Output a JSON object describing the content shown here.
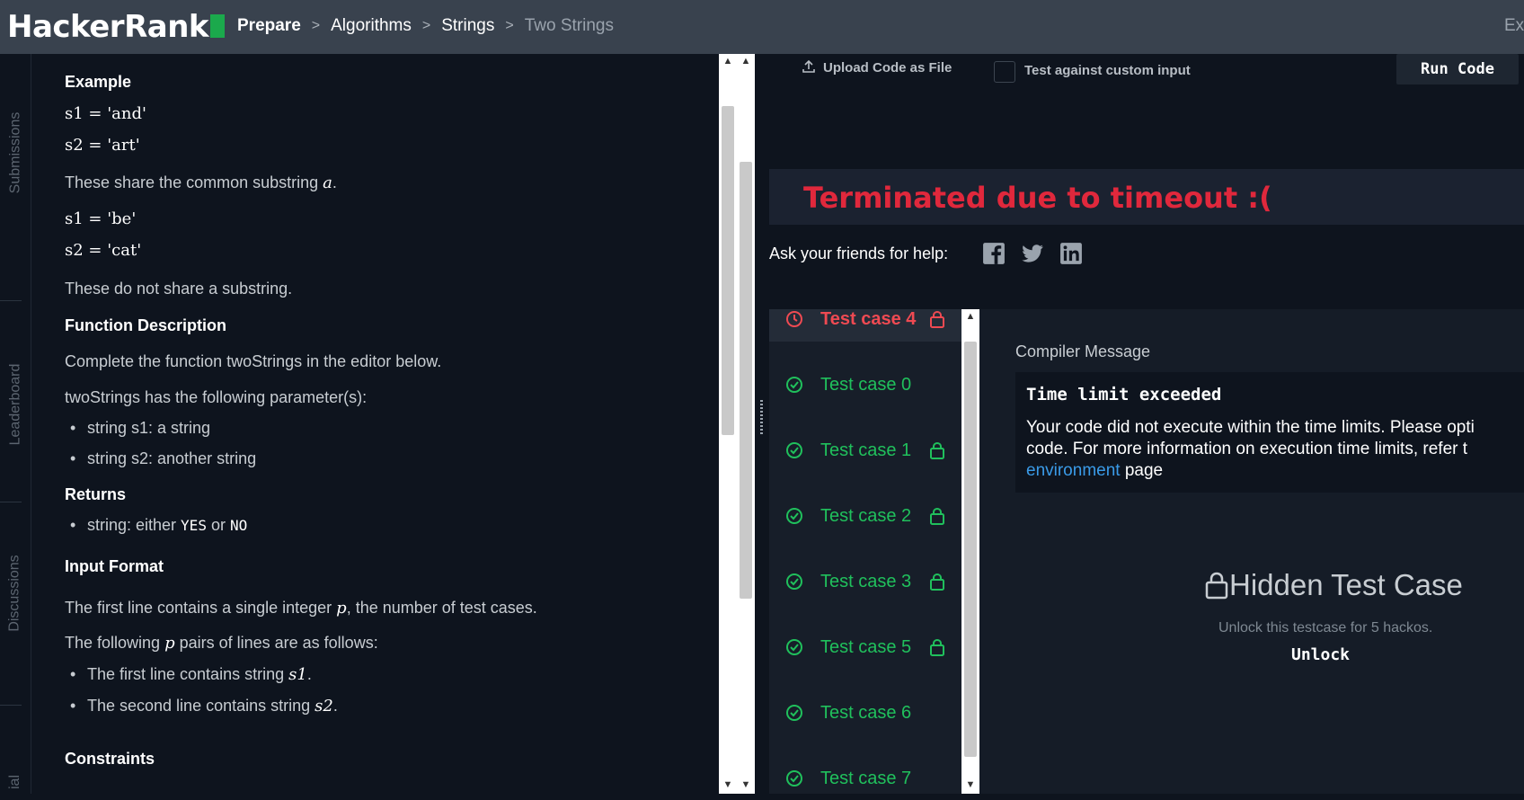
{
  "header": {
    "logo": "HackerRank",
    "breadcrumbs": [
      "Prepare",
      "Algorithms",
      "Strings",
      "Two Strings"
    ],
    "exit_label": "Exi"
  },
  "leftnav": {
    "tabs": [
      "Submissions",
      "Leaderboard",
      "Discussions",
      "ial"
    ]
  },
  "problem": {
    "example_heading": "Example",
    "ex1_s1": "s1 = 'and'",
    "ex1_s2": "s2 = 'art'",
    "ex1_note_a": "These share the common substring ",
    "ex1_note_var": "a",
    "ex1_note_b": ".",
    "ex2_s1": "s1 = 'be'",
    "ex2_s2": "s2 = 'cat'",
    "ex2_note": "These do not share a substring.",
    "fd_heading": "Function Description",
    "fd_text": "Complete the function twoStrings in the editor below.",
    "params_text": "twoStrings has the following parameter(s):",
    "param1": "string s1: a string",
    "param2": "string s2: another string",
    "returns_heading": "Returns",
    "returns_a": "string: either ",
    "returns_yes": "YES",
    "returns_or": " or ",
    "returns_no": "NO",
    "input_heading": "Input Format",
    "input_line1_a": "The first line contains a single integer ",
    "input_line1_var": "p",
    "input_line1_b": ", the number of test cases.",
    "input_line2_a": "The following ",
    "input_line2_var": "p",
    "input_line2_b": " pairs of lines are as follows:",
    "input_b1_a": "The first line contains string ",
    "input_b1_var": "s1",
    "input_b1_b": ".",
    "input_b2_a": "The second line contains string ",
    "input_b2_var": "s2",
    "input_b2_b": ".",
    "constraints_heading": "Constraints"
  },
  "editor": {
    "upload_label": "Upload Code as File",
    "custom_input_label": "Test against custom input",
    "run_label": "Run Code"
  },
  "result": {
    "status": "Terminated due to timeout :(",
    "ask_label": "Ask your friends for help:",
    "social_icons": [
      "facebook-icon",
      "twitter-icon",
      "linkedin-icon"
    ],
    "testcases": [
      {
        "label": "Test case 4",
        "state": "fail",
        "locked": true
      },
      {
        "label": "Test case 0",
        "state": "pass",
        "locked": false
      },
      {
        "label": "Test case 1",
        "state": "pass",
        "locked": true
      },
      {
        "label": "Test case 2",
        "state": "pass",
        "locked": true
      },
      {
        "label": "Test case 3",
        "state": "pass",
        "locked": true
      },
      {
        "label": "Test case 5",
        "state": "pass",
        "locked": true
      },
      {
        "label": "Test case 6",
        "state": "pass",
        "locked": false
      },
      {
        "label": "Test case 7",
        "state": "pass",
        "locked": false
      }
    ],
    "compiler_label": "Compiler Message",
    "compiler_heading": "Time limit exceeded",
    "compiler_line1": "Your code did not execute within the time limits. Please opti",
    "compiler_line2": "code. For more information on execution time limits, refer t",
    "compiler_link": "environment",
    "compiler_after_link": " page",
    "hidden_title": "Hidden Test Case",
    "unlock_text": "Unlock this testcase for 5 hackos.",
    "unlock_button": "Unlock"
  },
  "colors": {
    "bg": "#0e141e",
    "header": "#39424e",
    "pass": "#20c05c",
    "fail": "#ef4a52",
    "timeout": "#e0283c",
    "brand": "#1ba94c",
    "link": "#3a9be8"
  }
}
